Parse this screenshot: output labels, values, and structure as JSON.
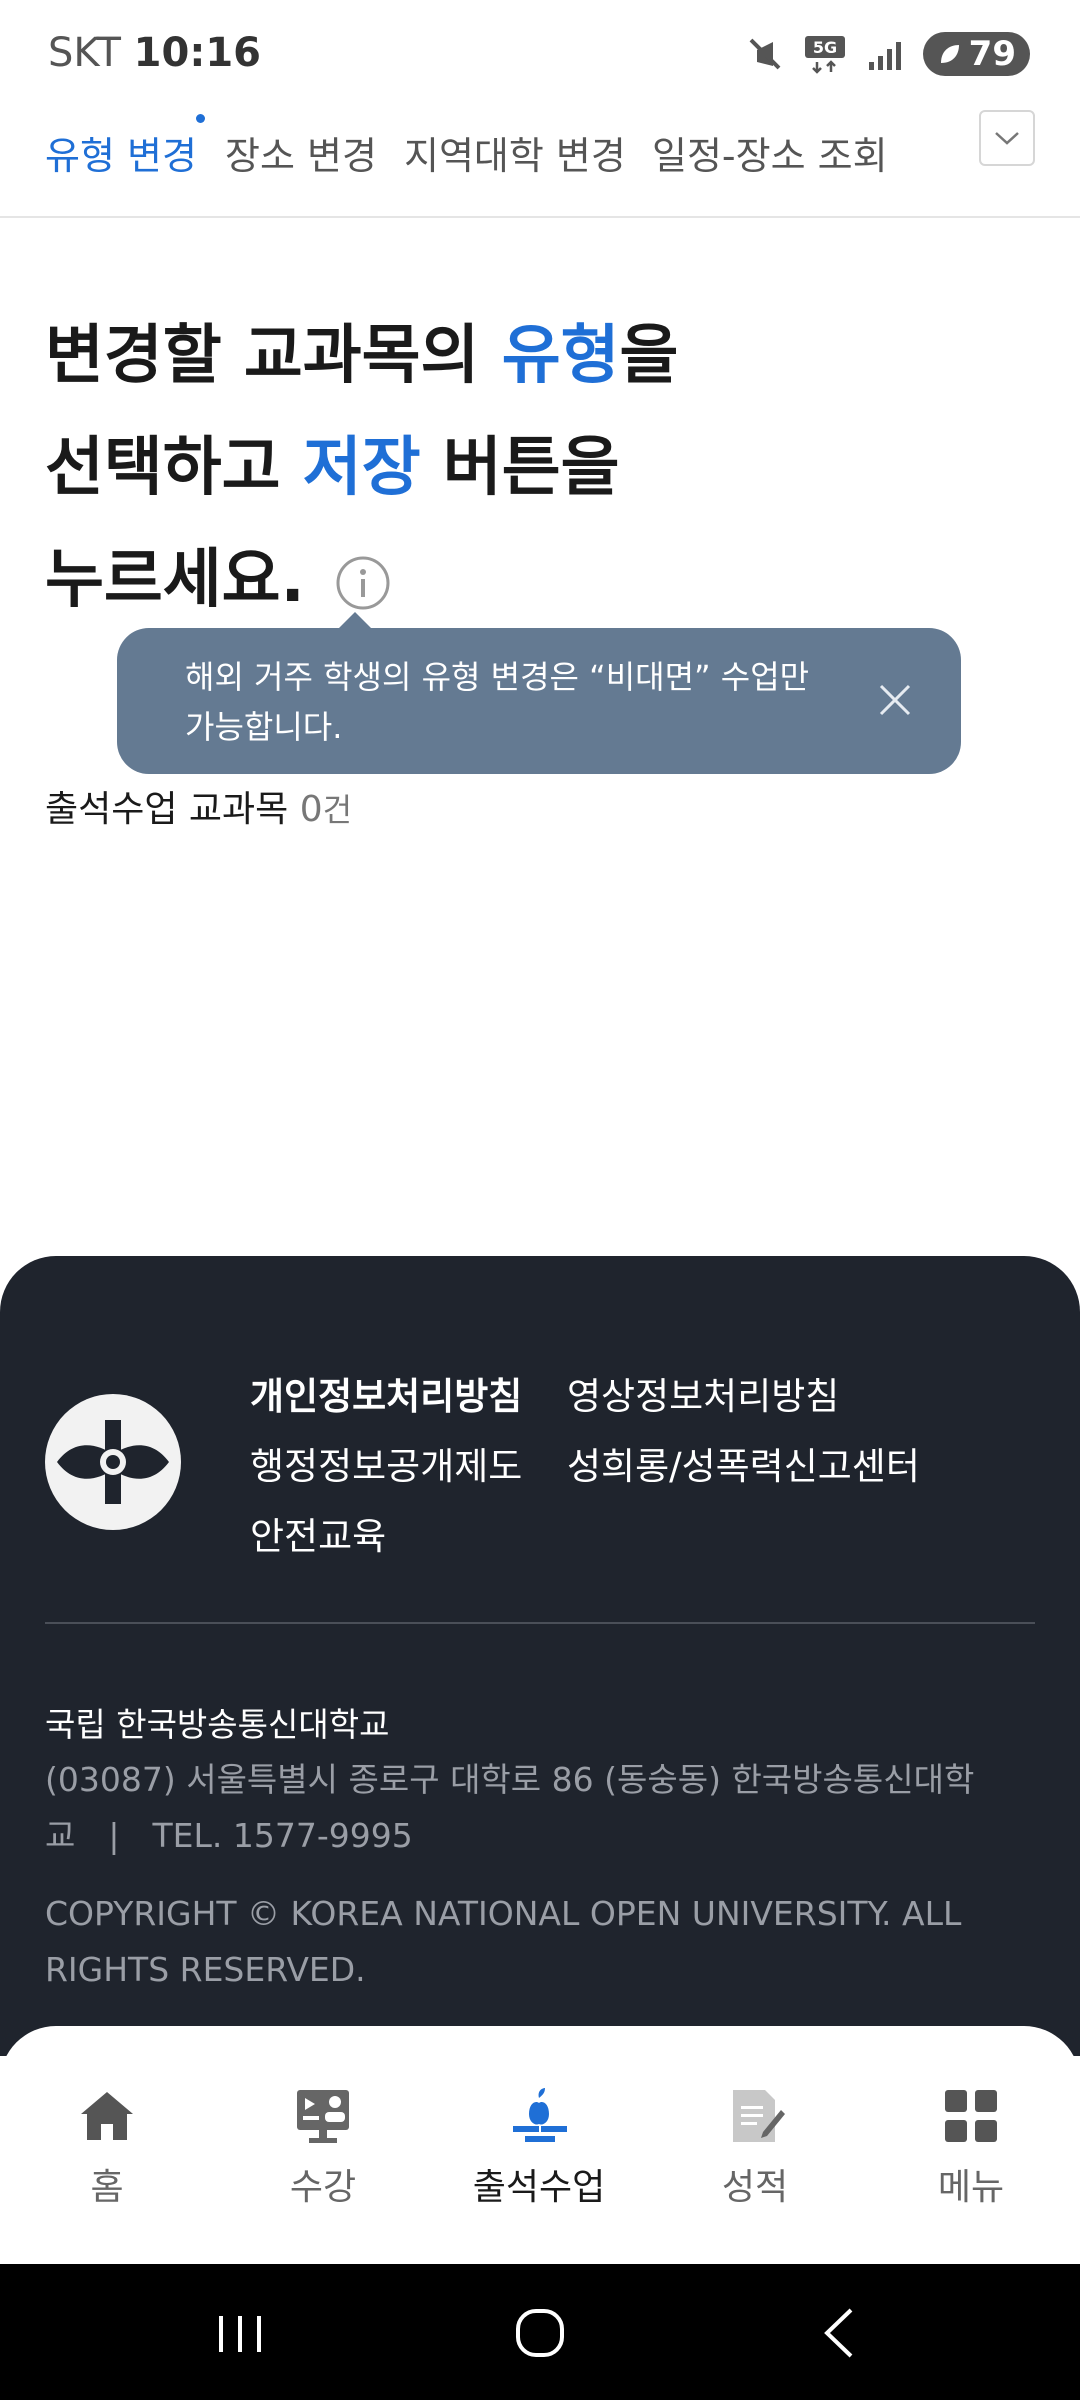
{
  "status_bar": {
    "carrier": "SKT",
    "time": "10:16",
    "network": "5G",
    "battery": "79"
  },
  "tabs": [
    {
      "label": "유형 변경",
      "active": true
    },
    {
      "label": "장소 변경",
      "active": false
    },
    {
      "label": "지역대학 변경",
      "active": false
    },
    {
      "label": "일정-장소 조회",
      "active": false
    }
  ],
  "headline": {
    "line1_a": "변경할 교과목의 ",
    "line1_b": "유형",
    "line1_c": "을",
    "line2_a": "선택하고 ",
    "line2_b": "저장",
    "line2_c": " 버튼을",
    "line3": "누르세요."
  },
  "tooltip": {
    "text": "해외 거주 학생의 유형 변경은 “비대면” 수업만 가능합니다."
  },
  "course_count": {
    "label": "출석수업 교과목 ",
    "value": "0",
    "unit": "건"
  },
  "footer": {
    "links": [
      "개인정보처리방침",
      "영상정보처리방침",
      "행정정보공개제도",
      "성희롱/성폭력신고센터",
      "안전교육"
    ],
    "university": "국립 한국방송통신대학교",
    "address": "(03087) 서울특별시 종로구 대학로 86 (동숭동) 한국방송통신대학교　|　TEL. 1577-9995",
    "copyright": "COPYRIGHT © KOREA NATIONAL OPEN UNIVERSITY. ALL RIGHTS RESERVED."
  },
  "bottom_nav": [
    {
      "label": "홈",
      "icon": "home-icon",
      "active": false
    },
    {
      "label": "수강",
      "icon": "lecture-icon",
      "active": false
    },
    {
      "label": "출석수업",
      "icon": "attendance-icon",
      "active": true
    },
    {
      "label": "성적",
      "icon": "grades-icon",
      "active": false
    },
    {
      "label": "메뉴",
      "icon": "menu-grid-icon",
      "active": false
    }
  ],
  "colors": {
    "accent": "#1f6fd6",
    "tooltip_bg": "#647a92",
    "footer_bg": "#1f242d"
  }
}
